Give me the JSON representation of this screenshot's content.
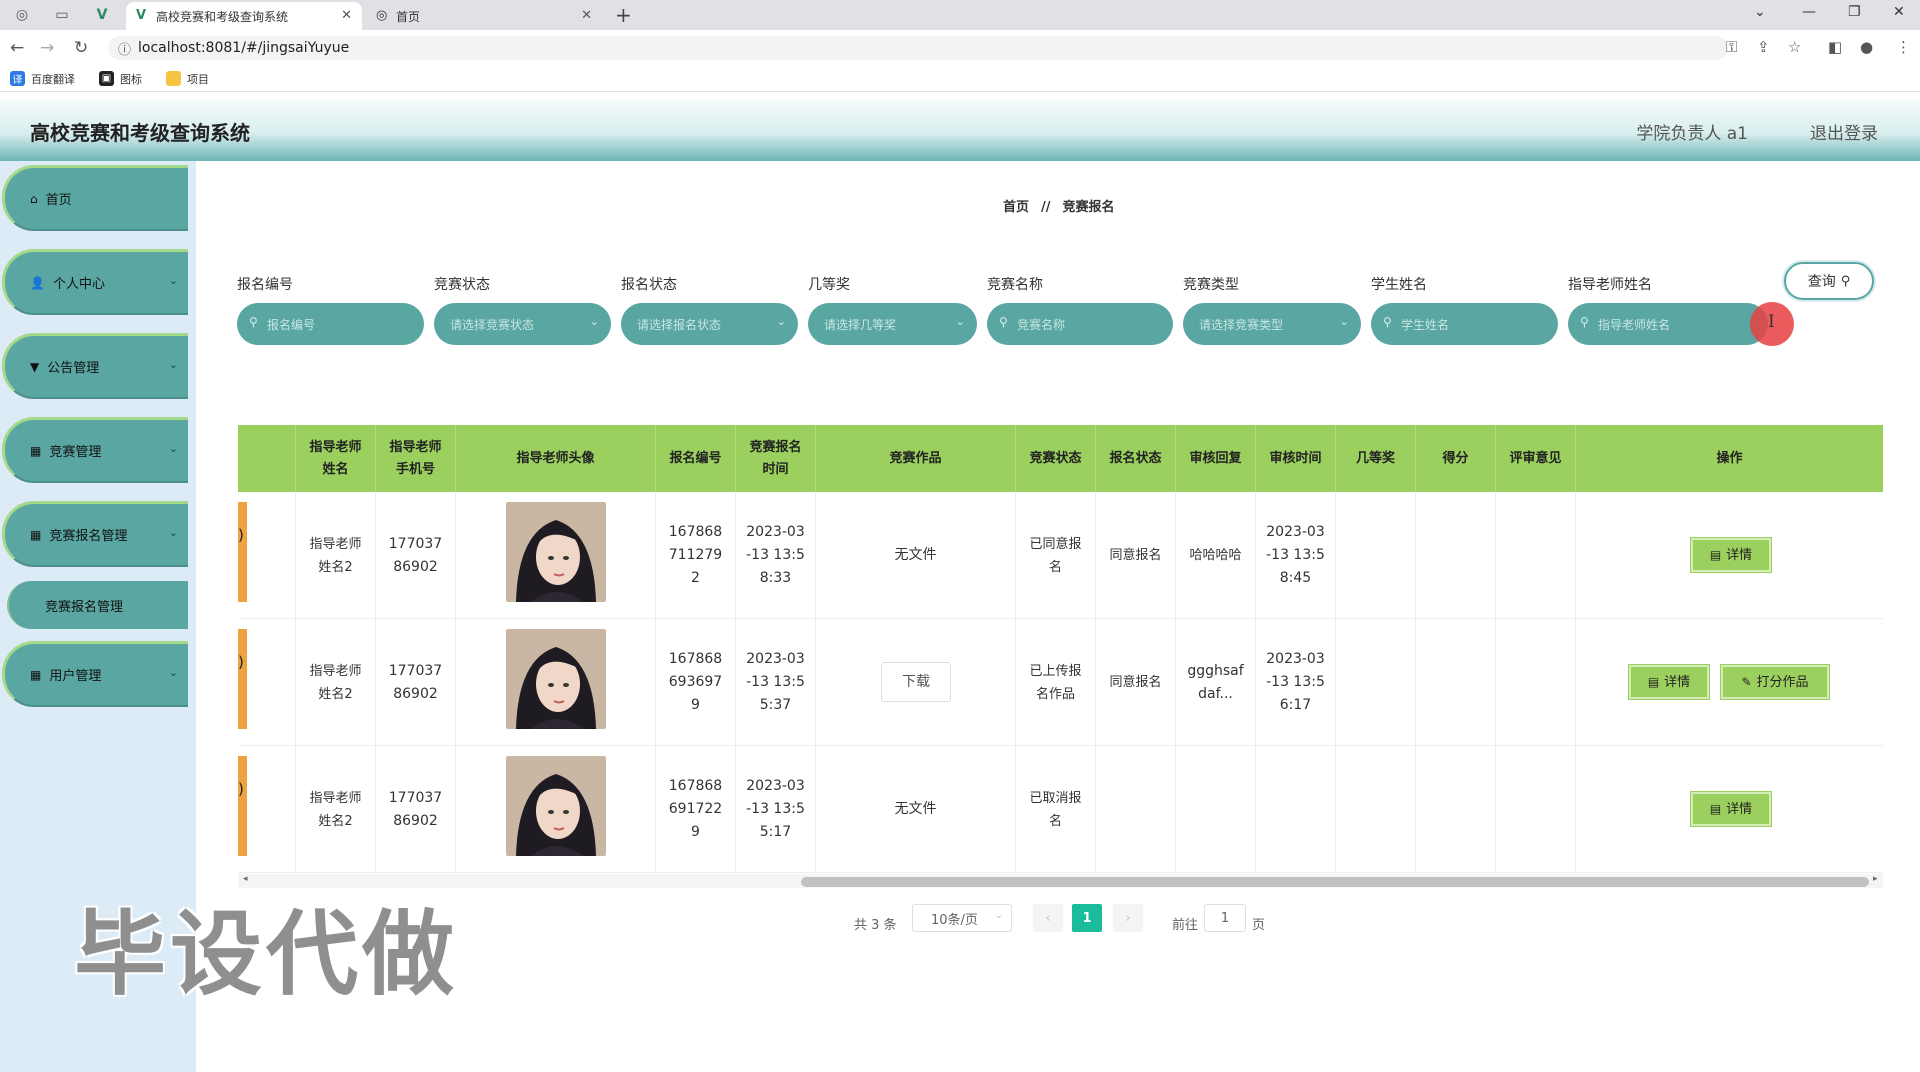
{
  "browser": {
    "tabs": [
      {
        "label": "高校竞赛和考级查询系统",
        "icon": "vue-icon",
        "active": true
      },
      {
        "label": "首页",
        "icon": "globe-icon",
        "active": false
      }
    ],
    "url": "localhost:8081/#/jingsaiYuyue",
    "bookmarks": [
      {
        "label": "百度翻译",
        "icon": "translate-icon",
        "color": "#2c7be5"
      },
      {
        "label": "图标",
        "icon": "image-icon",
        "color": "#222222"
      },
      {
        "label": "项目",
        "icon": "folder-icon",
        "color": "#f5c542"
      }
    ]
  },
  "header": {
    "title": "高校竞赛和考级查询系统",
    "user": "学院负责人 a1",
    "logout": "退出登录"
  },
  "sidebar": {
    "items": [
      {
        "label": "首页",
        "icon": "home-icon",
        "expandable": false
      },
      {
        "label": "个人中心",
        "icon": "user-icon",
        "expandable": true
      },
      {
        "label": "公告管理",
        "icon": "notice-icon",
        "expandable": true
      },
      {
        "label": "竞赛管理",
        "icon": "grid-icon",
        "expandable": true
      },
      {
        "label": "竞赛报名管理",
        "icon": "grid-icon",
        "expandable": true
      },
      {
        "label": "用户管理",
        "icon": "grid-icon",
        "expandable": true
      }
    ],
    "subitem": "竞赛报名管理"
  },
  "breadcrumb": {
    "home": "首页",
    "separator": "//",
    "current": "竞赛报名"
  },
  "filters": [
    {
      "label": "报名编号",
      "placeholder": "报名编号",
      "type": "input"
    },
    {
      "label": "竞赛状态",
      "placeholder": "请选择竞赛状态",
      "type": "select"
    },
    {
      "label": "报名状态",
      "placeholder": "请选择报名状态",
      "type": "select"
    },
    {
      "label": "几等奖",
      "placeholder": "请选择几等奖",
      "type": "select"
    },
    {
      "label": "竞赛名称",
      "placeholder": "竞赛名称",
      "type": "input"
    },
    {
      "label": "竞赛类型",
      "placeholder": "请选择竞赛类型",
      "type": "select"
    },
    {
      "label": "学生姓名",
      "placeholder": "学生姓名",
      "type": "input"
    },
    {
      "label": "指导老师姓名",
      "placeholder": "指导老师姓名",
      "type": "input"
    }
  ],
  "query_button": "查询",
  "table": {
    "columns": [
      "",
      "指导老师姓名",
      "指导老师手机号",
      "指导老师头像",
      "报名编号",
      "竞赛报名时间",
      "竞赛作品",
      "竞赛状态",
      "报名状态",
      "审核回复",
      "审核时间",
      "几等奖",
      "得分",
      "评审意见",
      "操作"
    ],
    "rows": [
      {
        "lead": ")",
        "teacher": "指导老师姓名2",
        "phone": "17703786902",
        "reg_no": "1678687112792",
        "reg_time": "2023-03-13 13:58:33",
        "work": "无文件",
        "comp_status": "已同意报名",
        "reg_status": "同意报名",
        "reply": "哈哈哈哈",
        "review_time": "2023-03-13 13:58:45",
        "award": "",
        "score": "",
        "opinion": "",
        "actions": [
          "详情"
        ]
      },
      {
        "lead": ")",
        "teacher": "指导老师姓名2",
        "phone": "17703786902",
        "reg_no": "1678686936979",
        "reg_time": "2023-03-13 13:55:37",
        "work": "下载",
        "comp_status": "已上传报名作品",
        "reg_status": "同意报名",
        "reply": "ggghsafdaf...",
        "review_time": "2023-03-13 13:56:17",
        "award": "",
        "score": "",
        "opinion": "",
        "actions": [
          "详情",
          "打分作品"
        ]
      },
      {
        "lead": ")",
        "teacher": "指导老师姓名2",
        "phone": "17703786902",
        "reg_no": "1678686917229",
        "reg_time": "2023-03-13 13:55:17",
        "work": "无文件",
        "comp_status": "已取消报名",
        "reg_status": "",
        "reply": "",
        "review_time": "",
        "award": "",
        "score": "",
        "opinion": "",
        "actions": [
          "详情"
        ]
      }
    ]
  },
  "pagination": {
    "total": "共 3 条",
    "page_size": "10条/页",
    "current": "1",
    "goto_label": "前往",
    "goto_value": "1",
    "page_unit": "页"
  },
  "watermark": "毕设代做",
  "colors": {
    "teal": "#5aa6a2",
    "green": "#9bd05e",
    "accent": "#1abc9c",
    "orange": "#f0a240"
  }
}
